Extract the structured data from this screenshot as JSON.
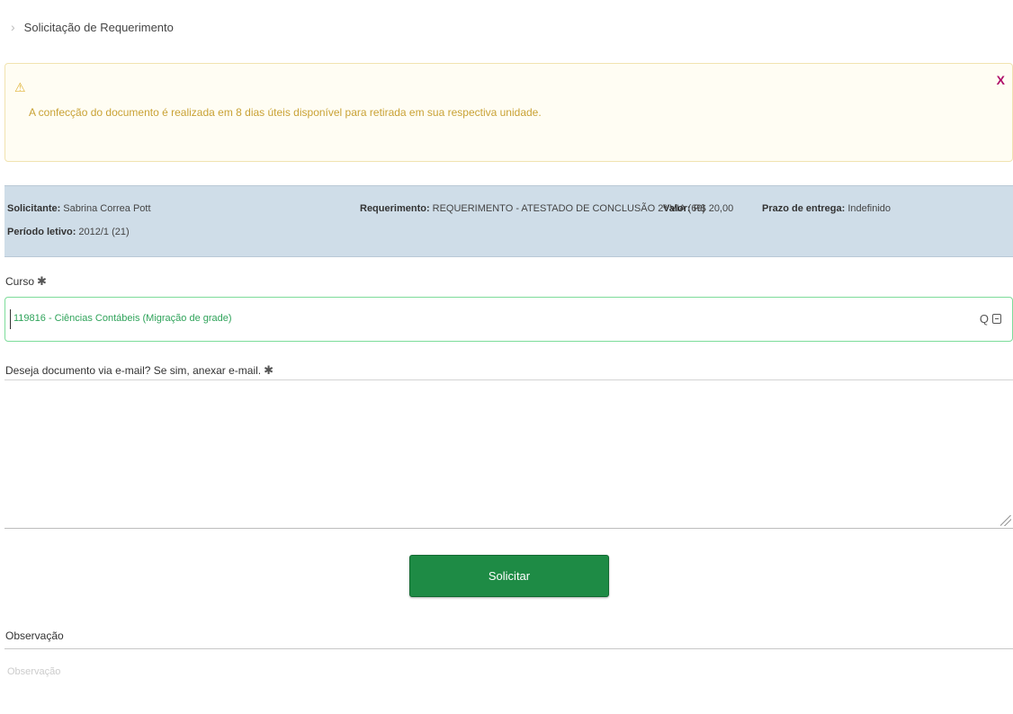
{
  "breadcrumb": {
    "separator": "›",
    "title": "Solicitação de Requerimento"
  },
  "alert": {
    "icon": "⚠",
    "message": "A confecção do documento é realizada em 8 dias úteis disponível para retirada em sua respectiva unidade.",
    "close": "X"
  },
  "info": {
    "solicitante_label": "Solicitante:",
    "solicitante_value": "Sabrina Correa Pott",
    "periodo_label": "Período letivo:",
    "periodo_value": "2012/1 (21)",
    "requerimento_label": "Requerimento:",
    "requerimento_value": "REQUERIMENTO - ATESTADO DE CONCLUSÃO 2ª VIA (69)",
    "valor_label": "Valor:",
    "valor_value": "R$ 20,00",
    "prazo_label": "Prazo de entrega:",
    "prazo_value": "Indefinido"
  },
  "form": {
    "curso_label": "Curso",
    "required_mark": "✱",
    "curso_value": "119816 - Ciências Contábeis (Migração de grade)",
    "search_glyph": "Q",
    "email_label": "Deseja documento via e-mail? Se sim, anexar e-mail.",
    "email_value": "",
    "submit_label": "Solicitar",
    "obs_label": "Observação",
    "obs_placeholder": "Observação"
  }
}
